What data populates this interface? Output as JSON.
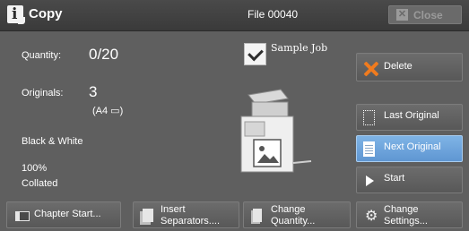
{
  "header": {
    "title": "Copy",
    "file": "File 00040",
    "close_label": "Close"
  },
  "status": {
    "quantity_label": "Quantity:",
    "quantity_value": "0/20",
    "originals_label": "Originals:",
    "originals_value": "3",
    "originals_size": "(A4 ▭)",
    "color_mode": "Black & White",
    "scale": "100%",
    "collation": "Collated"
  },
  "sample_job": {
    "label": "Sample Job",
    "checked": true
  },
  "actions": {
    "delete": "Delete",
    "last_original": "Last Original",
    "next_original": "Next Original",
    "start": "Start"
  },
  "toolbar": {
    "chapter_start": "Chapter Start...",
    "insert_separators_l1": "Insert",
    "insert_separators_l2": "Separators....",
    "change_quantity_l1": "Change",
    "change_quantity_l2": "Quantity...",
    "change_settings_l1": "Change",
    "change_settings_l2": "Settings..."
  },
  "colors": {
    "background": "#5f5f5f",
    "accent_blue": "#6fa6de",
    "delete_orange": "#f07b1e"
  },
  "icons": [
    "info-icon",
    "close-icon",
    "checkbox-checked-icon",
    "copier-icon",
    "delete-x-icon",
    "last-original-icon",
    "next-original-icon",
    "start-play-icon",
    "chapter-icon",
    "separators-icon",
    "quantity-icon",
    "gear-icon"
  ]
}
